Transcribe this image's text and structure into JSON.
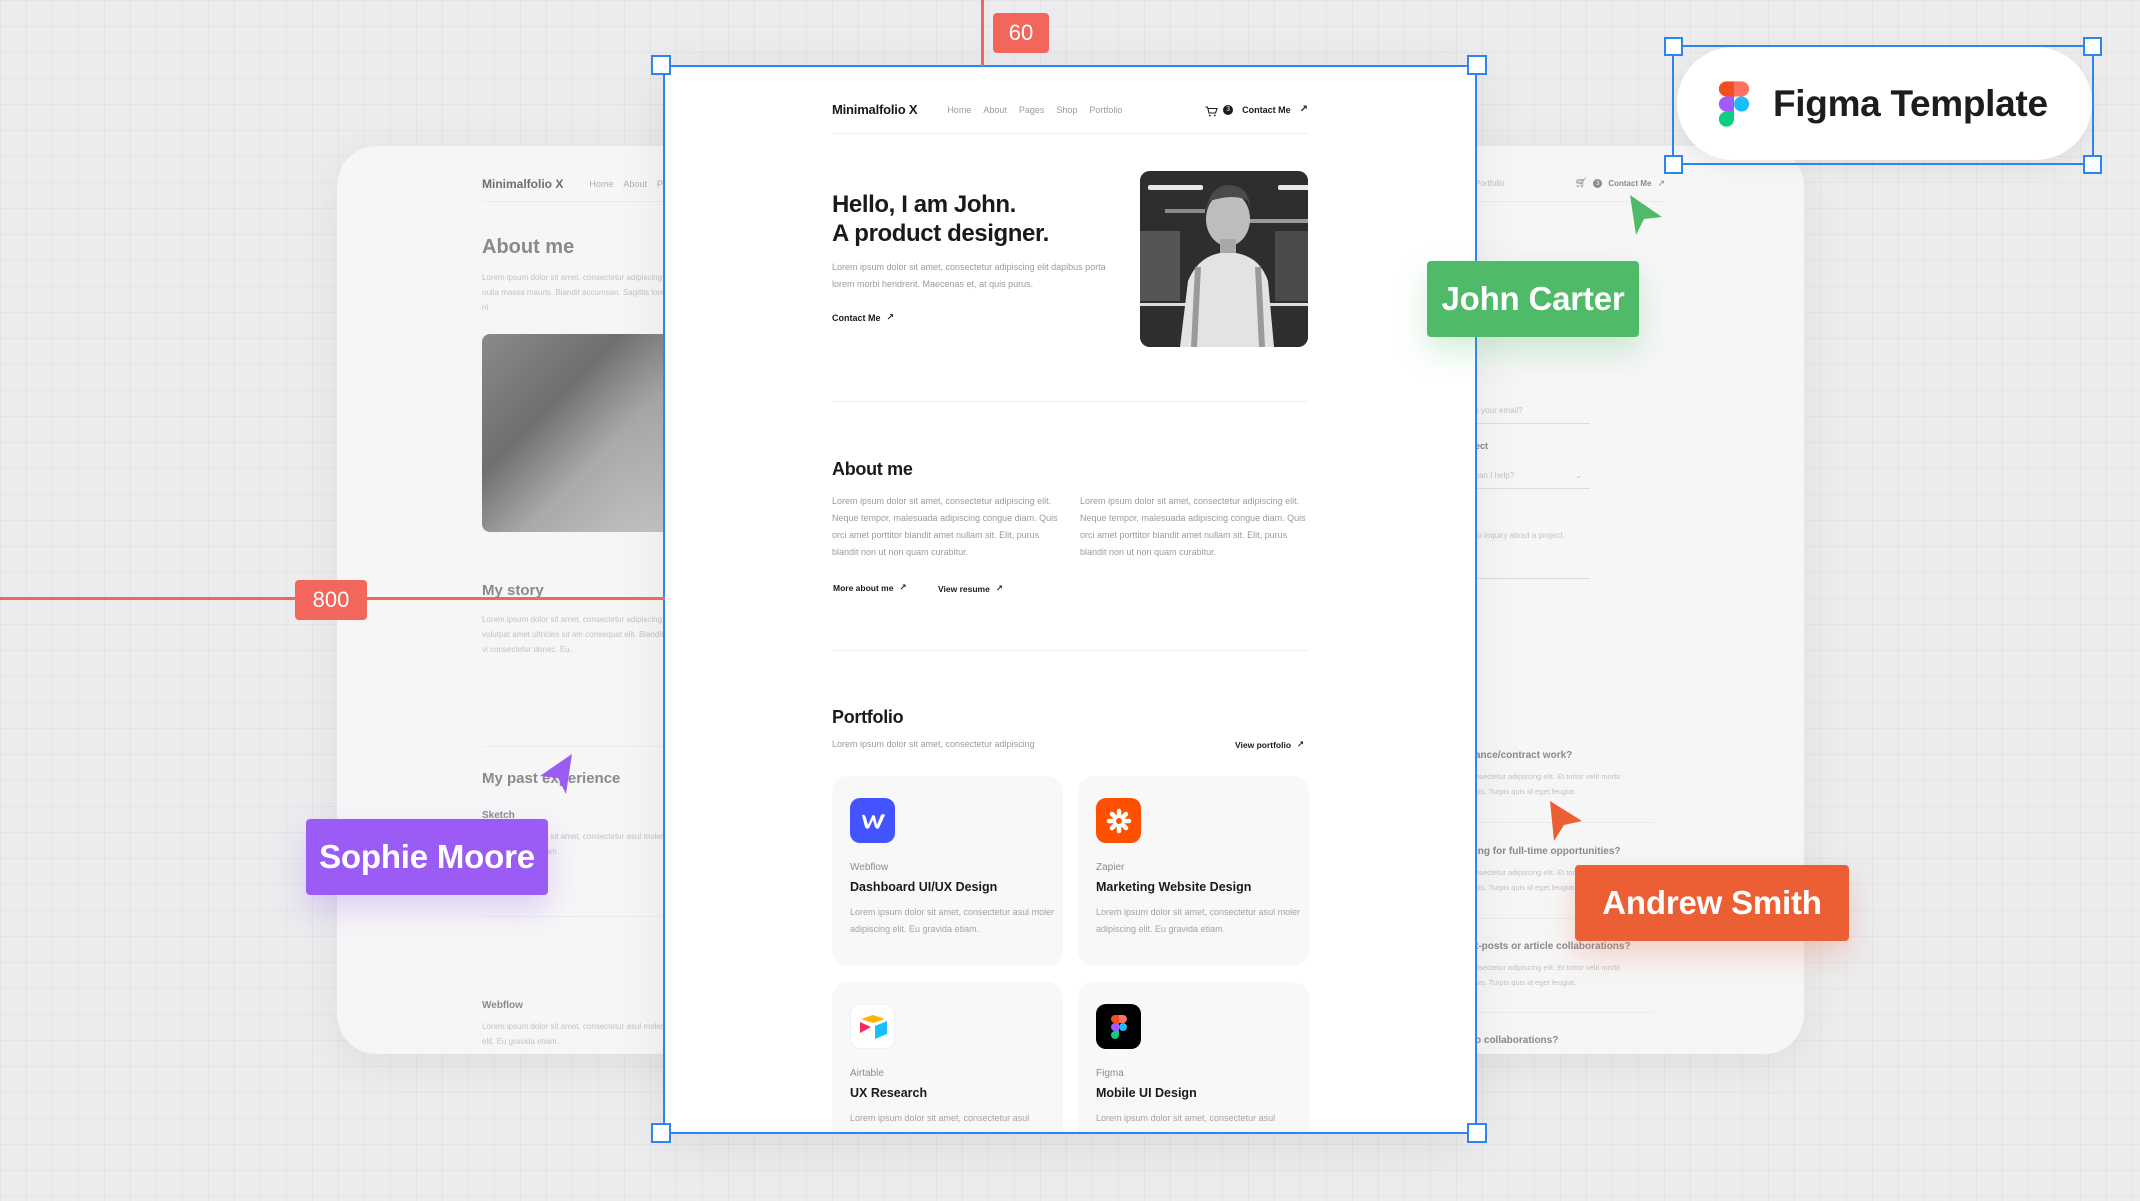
{
  "canvas": {
    "guide_top_value": "60",
    "guide_left_value": "800",
    "template_badge": "Figma Template"
  },
  "collaborators": [
    {
      "name": "John Carter",
      "color": "#4fba67"
    },
    {
      "name": "Sophie Moore",
      "color": "#9b5cf6"
    },
    {
      "name": "Andrew Smith",
      "color": "#ec5e33"
    }
  ],
  "main": {
    "nav": {
      "logo": "Minimalfolio X",
      "links": [
        "Home",
        "About",
        "Pages",
        "Shop",
        "Portfolio"
      ],
      "cart_count": "3",
      "contact": "Contact Me",
      "arrow": "↗"
    },
    "hero": {
      "title_line1": "Hello, I am John.",
      "title_line2": "A product designer.",
      "text": "Lorem ipsum dolor sit amet, consectetur adipiscing elit dapibus porta lorem morbi hendrerit. Maecenas et, at quis purus.",
      "cta": "Contact Me"
    },
    "about": {
      "title": "About me",
      "col1": "Lorem ipsum dolor sit amet, consectetur adipiscing elit. Neque tempor, malesuada adipiscing congue diam. Quis orci amet porttitor blandit amet nullam sit. Elit, purus blandit non ut non quam curabitur.",
      "col2": "Lorem ipsum dolor sit amet, consectetur adipiscing elit. Neque tempor, malesuada adipiscing congue diam. Quis orci amet porttitor blandit amet nullam sit. Elit, purus blandit non ut non quam curabitur.",
      "link1": "More about me",
      "link2": "View resume"
    },
    "portfolio": {
      "title": "Portfolio",
      "subtitle": "Lorem ipsum dolor sit amet, consectetur adipiscing",
      "view_all": "View portfolio",
      "cards": [
        {
          "brand": "Webflow",
          "title": "Dashboard UI/UX Design",
          "desc": "Lorem ipsum dolor sit amet, consectetur asul moler adipiscing elit. Eu gravida etiam.",
          "icon": "webflow-icon",
          "color": "#4353ff"
        },
        {
          "brand": "Zapier",
          "title": "Marketing Website Design",
          "desc": "Lorem ipsum dolor sit amet, consectetur asul moler adipiscing elit. Eu gravida etiam.",
          "icon": "zapier-icon",
          "color": "#ff4f00"
        },
        {
          "brand": "Airtable",
          "title": "UX Research",
          "desc": "Lorem ipsum dolor sit amet, consectetur asul",
          "icon": "airtable-icon",
          "color": "#ffffff"
        },
        {
          "brand": "Figma",
          "title": "Mobile UI Design",
          "desc": "Lorem ipsum dolor sit amet, consectetur asul",
          "icon": "figma-icon",
          "color": "#000000"
        }
      ]
    }
  },
  "left_page": {
    "logo": "Minimalfolio X",
    "links": [
      "Home",
      "About",
      "Pa"
    ],
    "about_title": "About me",
    "about_text": "Lorem ipsum dolor sit amet, consectetur adipiscing tristique. Aenean urna, nulla massa mauris. Blandit accumsan. Sagittis lorem phasellus fermentum ni",
    "story_title": "My story",
    "story_text": "Lorem ipsum dolor sit amet, consectetur adipiscing elit. Vestibulum non volutpat amet ultricies sit am consequat elit. Blandit sed mattis pulvinar non vi consectetur donec. Eu.",
    "experience_title": "My past experience",
    "exp1_title": "Sketch",
    "exp1_text": "Lorem ipsum dolor sit amet, consectetur asul moler adipiscing elit. Eu gravida etiam.",
    "exp2_title": "Webflow",
    "exp2_text": "Lorem ipsum dolor sit amet, consectetur asul moler adipiscing elit. Eu gravida etiam."
  },
  "right_page": {
    "nav_link": "Portfolio",
    "cart_count": "3",
    "contact": "Contact Me",
    "email_label": "l",
    "email_placeholder": "s your email?",
    "subject_label": "ect",
    "subject_placeholder": "can I help?",
    "message_placeholder": "to inquiry about a project.",
    "faq": [
      {
        "q": "ance/contract work?",
        "a1": "nsectetur adipiscing elit. Et tortor velit morbi",
        "a2": "uis. Turpis quis id eget feugiat."
      },
      {
        "q": "ing for full-time opportunities?",
        "a1": "nsectetur adipiscing elit. Et tortor velit morbi",
        "a2": "uis. Turpis quis id eget feugiat."
      },
      {
        "q": "t-posts or article collaborations?",
        "a1": "nsectetur adipiscing elit. Et tortor velit morbi",
        "a2": "uis. Turpis quis id eget feugiat."
      },
      {
        "q": "o collaborations?",
        "a1": "",
        "a2": ""
      }
    ]
  }
}
